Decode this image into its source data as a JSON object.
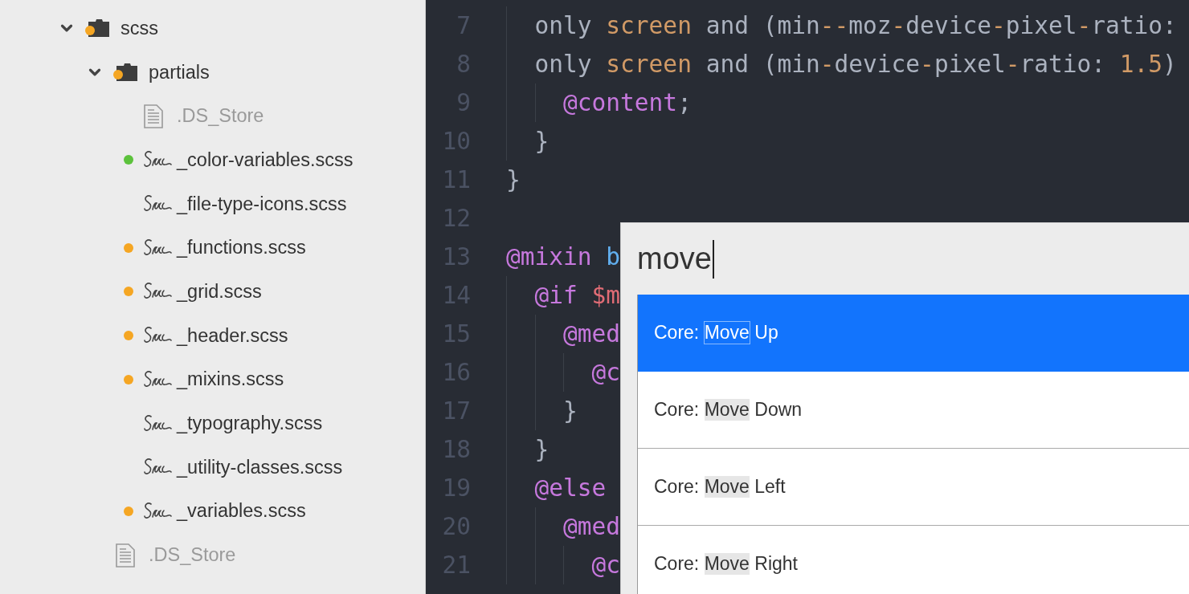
{
  "sidebar": {
    "tree": [
      {
        "kind": "folder",
        "name": "scss",
        "expanded": true,
        "color": "#f5a623",
        "children": [
          {
            "kind": "folder",
            "name": "partials",
            "expanded": true,
            "color": "#f5a623",
            "children": [
              {
                "kind": "file",
                "name": ".DS_Store",
                "ignored": true
              },
              {
                "kind": "sass",
                "name": "_color-variables.scss",
                "ignored": false,
                "color": "#5cc23c"
              },
              {
                "kind": "sass",
                "name": "_file-type-icons.scss",
                "ignored": false
              },
              {
                "kind": "sass",
                "name": "_functions.scss",
                "ignored": false,
                "color": "#f5a623"
              },
              {
                "kind": "sass",
                "name": "_grid.scss",
                "ignored": false,
                "color": "#f5a623"
              },
              {
                "kind": "sass",
                "name": "_header.scss",
                "ignored": false,
                "color": "#f5a623"
              },
              {
                "kind": "sass",
                "name": "_mixins.scss",
                "ignored": false,
                "color": "#f5a623"
              },
              {
                "kind": "sass",
                "name": "_typography.scss",
                "ignored": false
              },
              {
                "kind": "sass",
                "name": "_utility-classes.scss",
                "ignored": false
              },
              {
                "kind": "sass",
                "name": "_variables.scss",
                "ignored": false,
                "color": "#f5a623"
              }
            ]
          },
          {
            "kind": "file",
            "name": ".DS_Store",
            "ignored": true
          }
        ]
      }
    ]
  },
  "editor": {
    "lines": [
      {
        "number": "7",
        "tokens": [
          {
            "text": "  only ",
            "kind": "plain"
          },
          {
            "text": "screen",
            "kind": "keyword"
          },
          {
            "text": " and (min",
            "kind": "plain"
          },
          {
            "text": "--",
            "kind": "keyword"
          },
          {
            "text": "moz",
            "kind": "plain"
          },
          {
            "text": "-",
            "kind": "keyword"
          },
          {
            "text": "device",
            "kind": "plain"
          },
          {
            "text": "-",
            "kind": "keyword"
          },
          {
            "text": "pixel",
            "kind": "plain"
          },
          {
            "text": "-",
            "kind": "keyword"
          },
          {
            "text": "ratio:",
            "kind": "plain"
          }
        ]
      },
      {
        "number": "8",
        "tokens": [
          {
            "text": "  only ",
            "kind": "plain"
          },
          {
            "text": "screen",
            "kind": "keyword"
          },
          {
            "text": " and (min",
            "kind": "plain"
          },
          {
            "text": "-",
            "kind": "keyword"
          },
          {
            "text": "device",
            "kind": "plain"
          },
          {
            "text": "-",
            "kind": "keyword"
          },
          {
            "text": "pixel",
            "kind": "plain"
          },
          {
            "text": "-",
            "kind": "keyword"
          },
          {
            "text": "ratio: ",
            "kind": "plain"
          },
          {
            "text": "1.5",
            "kind": "keyword"
          },
          {
            "text": ")",
            "kind": "plain"
          }
        ]
      },
      {
        "number": "9",
        "tokens": [
          {
            "text": "    @content",
            "kind": "at"
          },
          {
            "text": ";",
            "kind": "plain"
          }
        ]
      },
      {
        "number": "10",
        "tokens": [
          {
            "text": "  }",
            "kind": "plain"
          }
        ]
      },
      {
        "number": "11",
        "tokens": [
          {
            "text": "}",
            "kind": "plain"
          }
        ]
      },
      {
        "number": "12"
      },
      {
        "number": "13",
        "tokens": [
          {
            "text": "@mixin",
            "kind": "at"
          },
          {
            "text": " b",
            "kind": "name"
          }
        ]
      },
      {
        "number": "14",
        "tokens": [
          {
            "text": "  @if",
            "kind": "at"
          },
          {
            "text": " $m",
            "kind": "variable"
          }
        ]
      },
      {
        "number": "15",
        "tokens": [
          {
            "text": "    @med",
            "kind": "at"
          }
        ]
      },
      {
        "number": "16",
        "tokens": [
          {
            "text": "      @c",
            "kind": "at"
          }
        ]
      },
      {
        "number": "17",
        "tokens": [
          {
            "text": "    }",
            "kind": "plain"
          }
        ]
      },
      {
        "number": "18",
        "tokens": [
          {
            "text": "  }",
            "kind": "plain"
          }
        ]
      },
      {
        "number": "19",
        "tokens": [
          {
            "text": "  @else",
            "kind": "at"
          }
        ]
      },
      {
        "number": "20",
        "tokens": [
          {
            "text": "    @med",
            "kind": "at"
          }
        ]
      },
      {
        "number": "21",
        "tokens": [
          {
            "text": "      @c",
            "kind": "at"
          }
        ]
      }
    ]
  },
  "command_palette": {
    "query": "move",
    "results": [
      {
        "prefix": "Core: ",
        "match": "Move",
        "suffix": " Up",
        "selected": true
      },
      {
        "prefix": "Core: ",
        "match": "Move",
        "suffix": " Down",
        "selected": false
      },
      {
        "prefix": "Core: ",
        "match": "Move",
        "suffix": " Left",
        "selected": false
      },
      {
        "prefix": "Core: ",
        "match": "Move",
        "suffix": " Right",
        "selected": false
      }
    ]
  }
}
